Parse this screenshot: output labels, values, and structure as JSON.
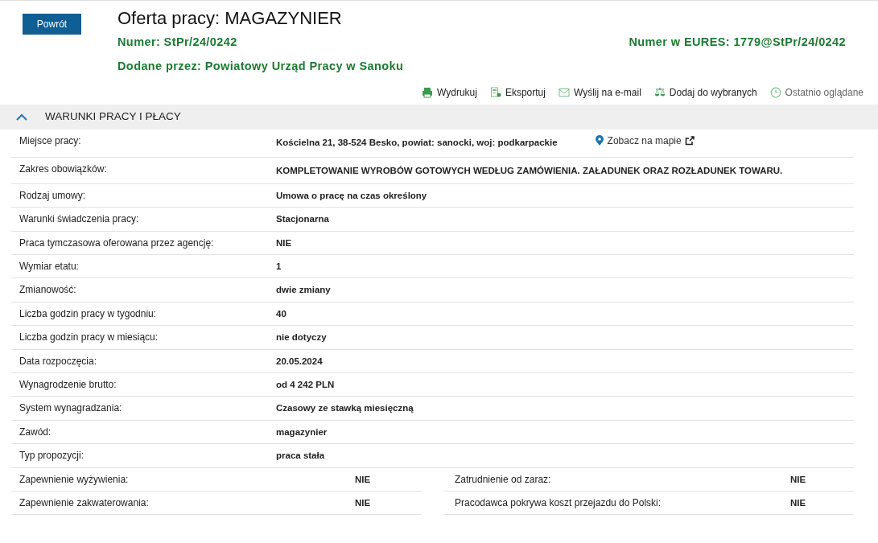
{
  "header": {
    "back_button": "Powrót",
    "title": "Oferta pracy: MAGAZYNIER",
    "number": {
      "label": "Numer:",
      "value": "StPr/24/0242"
    },
    "eures": {
      "label": "Numer w EURES:",
      "value": "1779@StPr/24/0242"
    },
    "added_by": {
      "label": "Dodane przez:",
      "value": "Powiatowy Urząd Pracy w Sanoku"
    }
  },
  "actions": [
    {
      "kind": "print",
      "label": "Wydrukuj"
    },
    {
      "kind": "export",
      "label": "Eksportuj"
    },
    {
      "kind": "email",
      "label": "Wyślij na e-mail"
    },
    {
      "kind": "favorite",
      "label": "Dodaj do wybranych"
    },
    {
      "kind": "recent",
      "label": "Ostatnio oglądane"
    }
  ],
  "section": {
    "title": "WARUNKI PRACY I PŁACY",
    "expanded": true
  },
  "rows": [
    {
      "label": "Miejsce pracy:",
      "value": "Kościelna 21, 38-524 Besko, powiat: sanocki, woj: podkarpackie",
      "map_link": "Zobacz na mapie"
    },
    {
      "label": "Zakres obowiązków:",
      "value": "KOMPLETOWANIE WYROBÓW GOTOWYCH WEDŁUG ZAMÓWIENIA. ZAŁADUNEK ORAZ ROZŁADUNEK TOWARU."
    },
    {
      "label": "Rodzaj umowy:",
      "value": "Umowa o pracę na czas określony"
    },
    {
      "label": "Warunki świadczenia pracy:",
      "value": "Stacjonarna"
    },
    {
      "label": "Praca tymczasowa oferowana przez agencję:",
      "value": "NIE"
    },
    {
      "label": "Wymiar etatu:",
      "value": "1"
    },
    {
      "label": "Zmianowość:",
      "value": "dwie zmiany"
    },
    {
      "label": "Liczba godzin pracy w tygodniu:",
      "value": "40"
    },
    {
      "label": "Liczba godzin pracy w miesiącu:",
      "value": "nie dotyczy"
    },
    {
      "label": "Data rozpoczęcia:",
      "value": "20.05.2024"
    },
    {
      "label": "Wynagrodzenie brutto:",
      "value": "od 4 242 PLN"
    },
    {
      "label": "System wynagradzania:",
      "value": "Czasowy ze stawką miesięczną"
    },
    {
      "label": "Zawód:",
      "value": "magazynier"
    },
    {
      "label": "Typ propozycji:",
      "value": "praca stała"
    }
  ],
  "pairs_left": [
    {
      "label": "Zapewnienie wyżywienia:",
      "value": "NIE"
    },
    {
      "label": "Zapewnienie zakwaterowania:",
      "value": "NIE"
    }
  ],
  "pairs_right": [
    {
      "label": "Zatrudnienie od zaraz:",
      "value": "NIE"
    },
    {
      "label": "Pracodawca pokrywa koszt przejazdu do Polski:",
      "value": "NIE"
    }
  ]
}
